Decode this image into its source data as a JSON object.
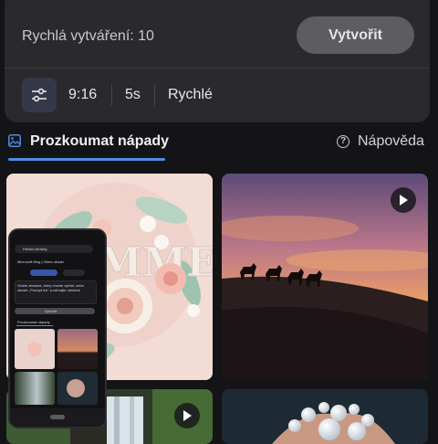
{
  "top_card": {
    "quick_creations": "Rychlá vytváření: 10",
    "create_button": "Vytvořit"
  },
  "options": {
    "settings_icon": "sliders-icon",
    "aspect": "9:16",
    "duration": "5s",
    "speed": "Rychlé"
  },
  "explore": {
    "icon": "image-icon",
    "label": "Prozkoumat nápady",
    "help_icon": "question-circle-icon",
    "help_label": "Nápověda"
  },
  "tiles": [
    {
      "name": "paper-flowers-summer",
      "has_play": false
    },
    {
      "name": "desert-camel-caravan-sunset",
      "has_play": true
    },
    {
      "name": "waterfall-forest",
      "has_play": true
    },
    {
      "name": "pearl-jewelry",
      "has_play": false
    }
  ],
  "phone_overlay": {
    "search": "Hledat obrázky",
    "brand": "Microsoft Bing | Video obsah",
    "prompt": "Vložte obrázek, který chcete vyfotit, nebo zkuste „Prompt ice“ a nahrajte obrázek",
    "tab_explore": "Prozkoumat nápady",
    "create": "Vytvořit",
    "accent": "#4a8ee8"
  },
  "colors": {
    "background": "#141416",
    "card": "#2a2a2d",
    "button": "#5d5d61",
    "accent": "#4a8ee8"
  }
}
